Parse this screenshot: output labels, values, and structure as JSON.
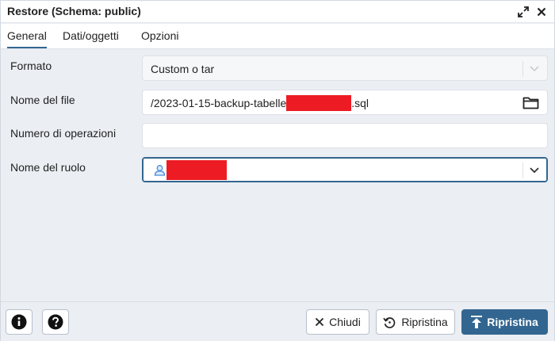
{
  "window": {
    "title": "Restore (Schema: public)"
  },
  "tabs": [
    {
      "label": "General",
      "active": true
    },
    {
      "label": "Dati/oggetti",
      "active": false
    },
    {
      "label": "Opzioni",
      "active": false
    }
  ],
  "form": {
    "format": {
      "label": "Formato",
      "value": "Custom o tar"
    },
    "filename": {
      "label": "Nome del file",
      "value_prefix": "/2023-01-15-backup-tabelle",
      "value_suffix": ".sql"
    },
    "jobs": {
      "label": "Numero di operazioni",
      "value": ""
    },
    "role": {
      "label": "Nome del ruolo",
      "value": ""
    }
  },
  "footer": {
    "close_label": "Chiudi",
    "reset_label": "Ripristina",
    "submit_label": "Ripristina"
  },
  "colors": {
    "primary": "#326690",
    "redaction": "#ed1c24",
    "background": "#ebeef3"
  },
  "icons": [
    "maximize-icon",
    "close-icon",
    "folder-icon",
    "user-icon",
    "chevron-down-icon",
    "info-icon",
    "help-icon",
    "x-icon",
    "reset-icon",
    "upload-icon"
  ]
}
